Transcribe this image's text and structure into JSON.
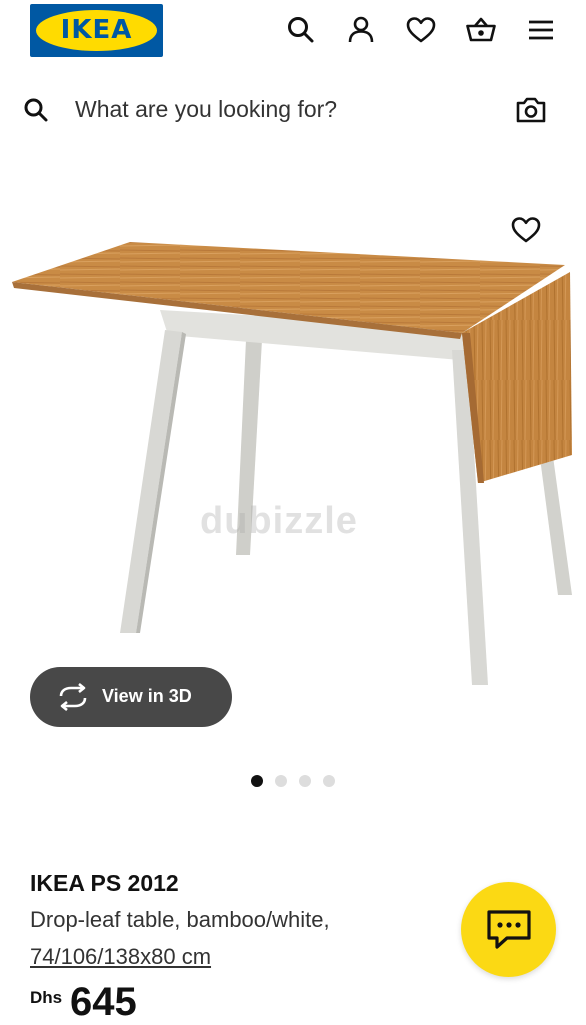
{
  "header": {
    "logo_text": "IKEA",
    "icons": [
      "search-icon",
      "account-icon",
      "heart-icon",
      "basket-icon",
      "menu-icon"
    ]
  },
  "search": {
    "placeholder": "What are you looking for?",
    "icons": [
      "search-icon",
      "camera-icon"
    ]
  },
  "gallery": {
    "watermark": "dubizzle",
    "view3d_label": "View in 3D",
    "dots_count": 4,
    "active_dot": 1
  },
  "product": {
    "name": "IKEA PS 2012",
    "description": "Drop-leaf table, bamboo/white,",
    "size": "74/106/138x80 cm",
    "currency": "Dhs",
    "price": "645"
  },
  "colors": {
    "brand_blue": "#0058a3",
    "brand_yellow": "#ffdb00",
    "chat_yellow": "#fbd914",
    "button_dark": "#484848",
    "wood": "#c98b45",
    "leg": "#d8d8d4"
  }
}
